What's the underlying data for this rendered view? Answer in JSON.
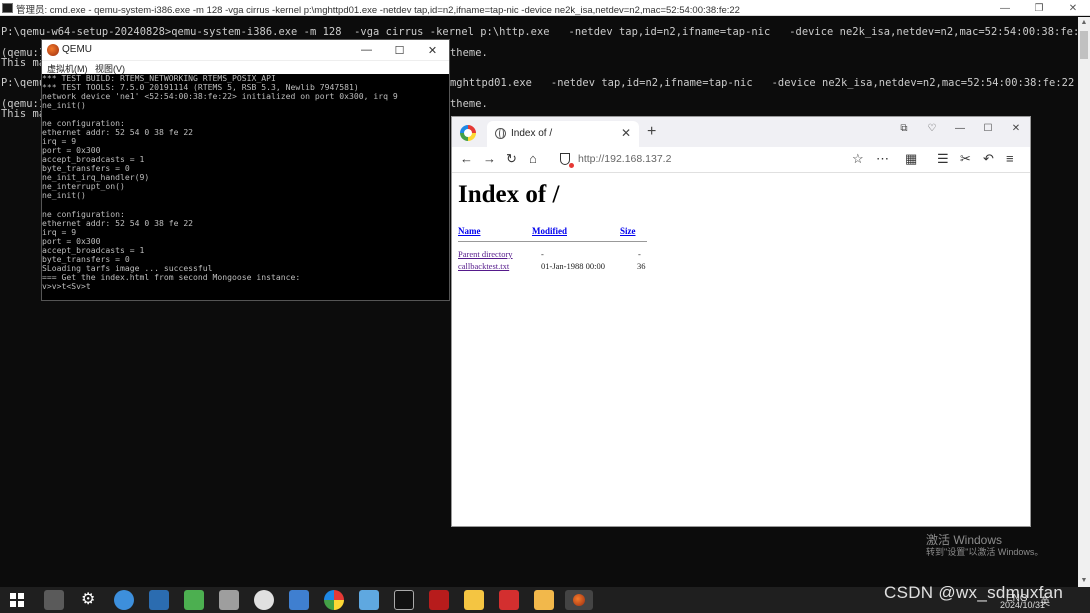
{
  "cmd": {
    "title": "管理员: cmd.exe - qemu-system-i386.exe  -m 128  -vga cirrus -kernel p:\\mghttpd01.exe   -netdev tap,id=n2,ifname=tap-nic   -device ne2k_isa,netdev=n2,mac=52:54:00:38:fe:22",
    "lines": [
      "P:\\qemu-w64-setup-20240828>qemu-system-i386.exe -m 128  -vga cirrus -kernel p:\\http.exe   -netdev tap,id=n2,ifname=tap-nic   -device ne2k_isa,netdev=n2,mac=52:54:00:38:fe:22",
      "(qemu:1",
      "This ma",
      "P:\\qemu",
      "(qemu:1",
      "This ma"
    ],
    "right_fragments": [
      "theme.",
      "mghttpd01.exe   -netdev tap,id=n2,ifname=tap-nic   -device ne2k_isa,netdev=n2,mac=52:54:00:38:fe:22",
      "theme."
    ]
  },
  "qemu": {
    "title": "QEMU",
    "menu": [
      "虚拟机(M)",
      "视图(V)"
    ],
    "console": [
      "*** TEST BUILD: RTEMS_NETWORKING RTEMS_POSIX_API",
      "*** TEST TOOLS: 7.5.0 20191114 (RTEMS 5, RSB 5.3, Newlib 7947581)",
      "network device 'ne1' <52:54:00:38:fe:22> initialized on port 0x300, irq 9",
      "ne_init()",
      "",
      "ne configuration:",
      "ethernet addr: 52 54 0 38 fe 22",
      "irq = 9",
      "port = 0x300",
      "accept_broadcasts = 1",
      "byte_transfers = 0",
      "ne_init_irq_handler(9)",
      "ne_interrupt_on()",
      "ne_init()",
      "",
      "ne configuration:",
      "ethernet addr: 52 54 0 38 fe 22",
      "irq = 9",
      "port = 0x300",
      "accept_broadcasts = 1",
      "byte_transfers = 0",
      "SLoading tarfs image ... successful",
      "=== Get the index.html from second Mongoose instance:",
      "v>v>t<Sv>t"
    ]
  },
  "browser": {
    "tab_label": "Index of /",
    "url": "http://192.168.137.2",
    "page": {
      "heading": "Index of /",
      "columns": [
        "Name",
        "Modified",
        "Size"
      ],
      "rows": [
        {
          "name": "Parent directory",
          "modified": "-",
          "size": "-"
        },
        {
          "name": "callbacktest.txt",
          "modified": "01-Jan-1988 00:00",
          "size": "36"
        }
      ]
    }
  },
  "watermark": {
    "line1": "激活 Windows",
    "line2": "转到\"设置\"以激活 Windows。"
  },
  "taskbar": {
    "tray_text": "英",
    "date": "2024/10/31",
    "tray_lang": "ENG"
  },
  "csdn_watermark": "CSDN @wx_sdmuxfan"
}
